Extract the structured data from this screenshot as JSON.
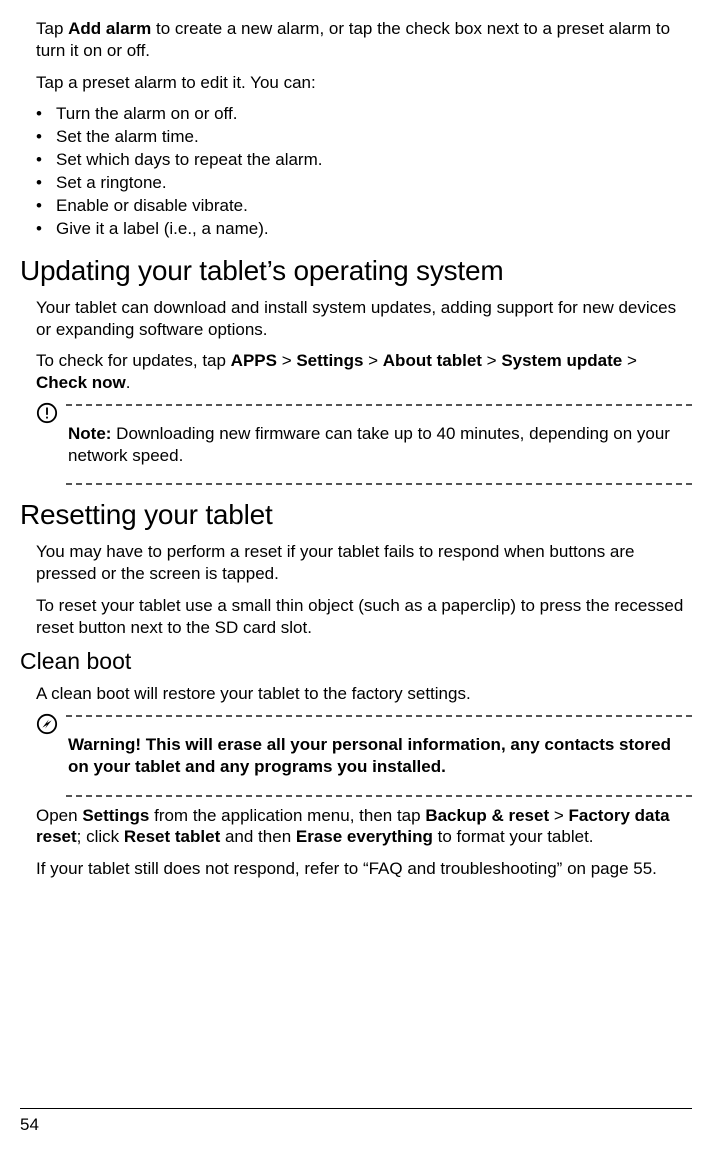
{
  "intro": {
    "p1_pre": "Tap ",
    "p1_b1": "Add alarm",
    "p1_post": " to create a new alarm, or tap the check box next to a preset alarm to turn it on or off.",
    "p2": "Tap a preset alarm to edit it. You can:"
  },
  "bullets": [
    "Turn the alarm on or off.",
    "Set the alarm time.",
    "Set which days to repeat the alarm.",
    "Set a ringtone.",
    "Enable or disable vibrate.",
    "Give it a label (i.e., a name)."
  ],
  "updating": {
    "heading": "Updating your tablet’s operating system",
    "p1": "Your tablet can download and install system updates, adding support for new devices or expanding software options.",
    "p2_pre": "To check for updates, tap ",
    "p2_b1": "APPS",
    "p2_s1": " > ",
    "p2_b2": "Settings",
    "p2_s2": " > ",
    "p2_b3": "About tablet",
    "p2_s3": " > ",
    "p2_b4": "System update",
    "p2_s4": " > ",
    "p2_b5": "Check now",
    "p2_post": ".",
    "note_label": "Note:",
    "note_body": " Downloading new firmware can take up to 40 minutes, depending on your network speed."
  },
  "resetting": {
    "heading": "Resetting your tablet",
    "p1": "You may have to perform a reset if your tablet fails to respond when buttons are pressed or the screen is tapped.",
    "p2": "To reset your tablet use a small thin object (such as a paperclip) to press the recessed reset button next to the SD card slot."
  },
  "cleanboot": {
    "heading": "Clean boot",
    "p1": "A clean boot will restore your tablet to the factory settings.",
    "warn": "Warning! This will erase all your personal information, any contacts stored on your tablet and any programs you installed.",
    "p2_pre": "Open ",
    "p2_b1": "Settings",
    "p2_mid1": " from the application menu, then tap ",
    "p2_b2": "Backup & reset",
    "p2_s1": " > ",
    "p2_b3": "Factory data reset",
    "p2_mid2": "; click ",
    "p2_b4": "Reset tablet",
    "p2_mid3": " and then ",
    "p2_b5": "Erase everything",
    "p2_post": " to format your tablet.",
    "p3": "If your tablet still does not respond, refer to “FAQ and troubleshooting” on page 55."
  },
  "page_number": "54"
}
